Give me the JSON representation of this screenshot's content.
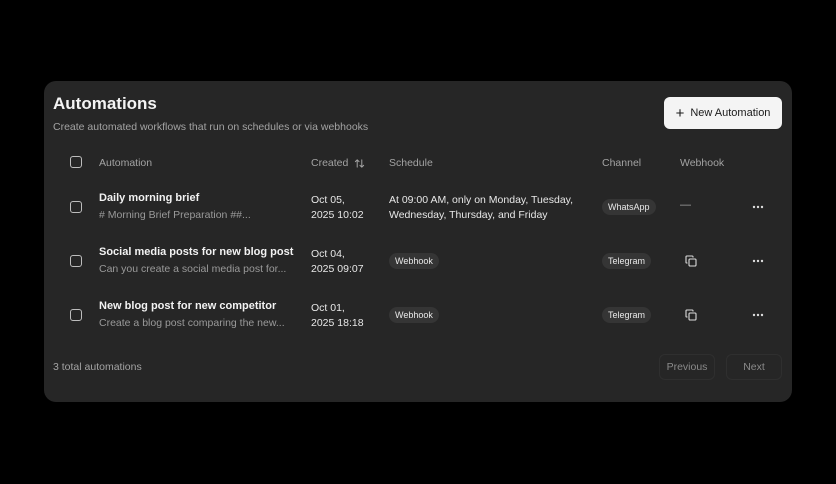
{
  "header": {
    "title": "Automations",
    "subtitle": "Create automated workflows that run on schedules or via webhooks",
    "new_button_label": "New Automation"
  },
  "columns": {
    "automation": "Automation",
    "created": "Created",
    "schedule": "Schedule",
    "channel": "Channel",
    "webhook": "Webhook"
  },
  "rows": [
    {
      "title": "Daily morning brief",
      "description": "# Morning Brief Preparation ##...",
      "created_date": "Oct 05,",
      "created_time": "2025 10:02",
      "schedule_line1": "At 09:00 AM, only on Monday, Tuesday,",
      "schedule_line2": "Wednesday, Thursday, and Friday",
      "channel": "WhatsApp",
      "webhook": "—"
    },
    {
      "title": "Social media posts for new blog post",
      "description": "Can you create a social media post for...",
      "created_date": "Oct 04,",
      "created_time": "2025 09:07",
      "schedule": "Webhook",
      "channel": "Telegram"
    },
    {
      "title": "New blog post for new competitor",
      "description": "Create a blog post comparing the new...",
      "created_date": "Oct 01,",
      "created_time": "2025 18:18",
      "schedule": "Webhook",
      "channel": "Telegram"
    }
  ],
  "footer": {
    "count_text": "3 total automations",
    "previous_label": "Previous",
    "next_label": "Next"
  },
  "icons": {
    "plus": "plus-icon",
    "sort": "sort-icon",
    "copy": "copy-icon",
    "more": "more-horizontal-icon"
  },
  "colors": {
    "background": "#000000",
    "card": "#262626",
    "pill": "#353535",
    "primary_button": "#f4f4f4"
  }
}
